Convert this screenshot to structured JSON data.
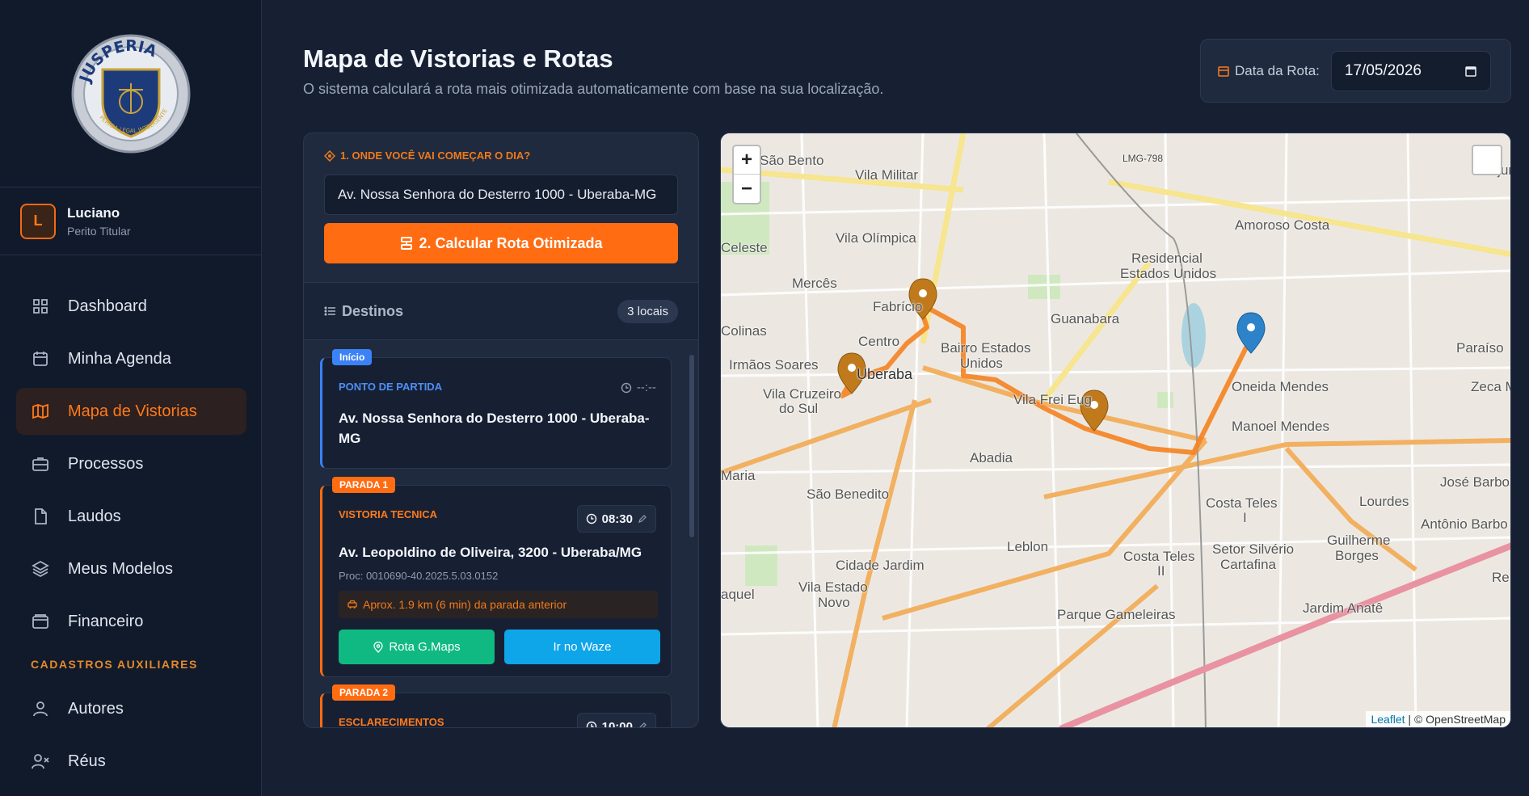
{
  "sidebar": {
    "logo_text": "JUSPERIA",
    "logo_tagline": "PERÍCIA LEGAL INTELIGENTE",
    "user": {
      "initial": "L",
      "name": "Luciano",
      "role": "Perito Titular"
    },
    "nav": [
      {
        "label": "Dashboard",
        "icon": "grid-icon",
        "active": false
      },
      {
        "label": "Minha Agenda",
        "icon": "calendar-icon",
        "active": false
      },
      {
        "label": "Mapa de Vistorias",
        "icon": "map-icon",
        "active": true
      },
      {
        "label": "Processos",
        "icon": "briefcase-icon",
        "active": false
      },
      {
        "label": "Laudos",
        "icon": "document-icon",
        "active": false
      },
      {
        "label": "Meus Modelos",
        "icon": "layers-icon",
        "active": false
      },
      {
        "label": "Financeiro",
        "icon": "wallet-icon",
        "active": false
      }
    ],
    "section_label": "CADASTROS AUXILIARES",
    "aux": [
      {
        "label": "Autores",
        "icon": "user-icon"
      },
      {
        "label": "Réus",
        "icon": "user-x-icon"
      }
    ]
  },
  "header": {
    "title": "Mapa de Vistorias e Rotas",
    "subtitle": "O sistema calculará a rota mais otimizada automaticamente com base na sua localização.",
    "date_label": "Data da Rota:",
    "date_value": "17/05/2026"
  },
  "panel": {
    "step1_label": "1. ONDE VOCÊ VAI COMEÇAR O DIA?",
    "start_address_value": "Av. Nossa Senhora do Desterro 1000 - Uberaba-MG",
    "calc_button": "2. Calcular Rota Otimizada",
    "destinations_title": "Destinos",
    "destinations_count": "3 locais",
    "start_card": {
      "tag": "Início",
      "kind": "PONTO DE PARTIDA",
      "time": "--:--",
      "address": "Av. Nossa Senhora do Desterro 1000 - Uberaba-MG"
    },
    "stops": [
      {
        "tag": "PARADA 1",
        "kind": "VISTORIA TECNICA",
        "time": "08:30",
        "address": "Av. Leopoldino de Oliveira, 3200 - Uberaba/MG",
        "proc": "Proc: 0010690-40.2025.5.03.0152",
        "distance": "Aprox. 1.9 km (6 min) da parada anterior",
        "gmaps_button": "Rota G.Maps",
        "waze_button": "Ir no Waze"
      },
      {
        "tag": "PARADA 2",
        "kind": "ESCLARECIMENTOS",
        "time": "10:00"
      }
    ]
  },
  "map": {
    "zoom_in": "+",
    "zoom_out": "−",
    "attribution_leaflet": "Leaflet",
    "attribution_osm": "| © OpenStreetMap",
    "labels": [
      "São Bento",
      "Vila Militar",
      "LMG-798",
      "Conjun",
      "Celeste",
      "Vila Olímpica",
      "Amoroso Costa",
      "Residencial",
      "Estados Unidos",
      "Mercês",
      "Fabrício",
      "Guanabara",
      "Colinas",
      "Centro",
      "Bairro Estados",
      "Unidos",
      "Paraíso",
      "Irmãos Soares",
      "Uberaba",
      "Vila Cruzeiro",
      "do Sul",
      "Vila Frei Eug",
      "Oneida Mendes",
      "Zeca M",
      "Manoel Mendes",
      "Abadia",
      "Maria",
      "São Benedito",
      "José Barbos",
      "Costa Teles",
      "I",
      "Lourdes",
      "Antônio Barbo",
      "Leblon",
      "Guilherme",
      "Borges",
      "Setor Silvério",
      "Cartafina",
      "Costa Teles",
      "II",
      "Cidade Jardim",
      "Vila Estado",
      "Novo",
      "aquel",
      "Parque Gameleiras",
      "Jardim Anatê",
      "Re"
    ]
  }
}
